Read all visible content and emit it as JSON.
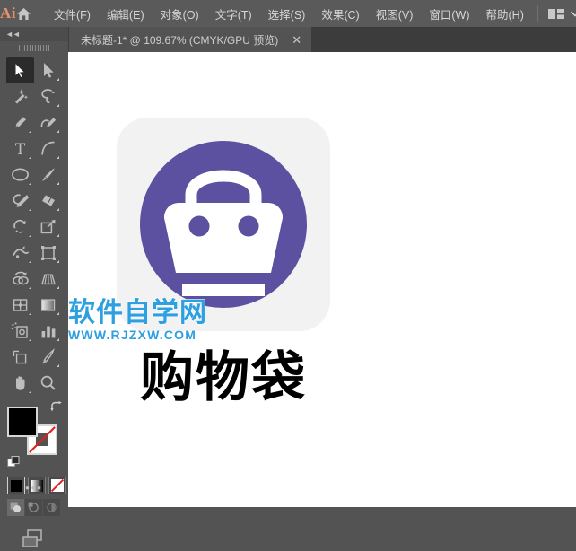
{
  "app": {
    "logo_text": "Ai",
    "accent_color": "#e8916b",
    "chrome_color": "#535353",
    "menubar_color": "#5a5a5a"
  },
  "menubar": {
    "home_icon": "home-icon",
    "items": [
      {
        "label": "文件(F)",
        "name": "menu-file"
      },
      {
        "label": "编辑(E)",
        "name": "menu-edit"
      },
      {
        "label": "对象(O)",
        "name": "menu-object"
      },
      {
        "label": "文字(T)",
        "name": "menu-type"
      },
      {
        "label": "选择(S)",
        "name": "menu-select"
      },
      {
        "label": "效果(C)",
        "name": "menu-effect"
      },
      {
        "label": "视图(V)",
        "name": "menu-view"
      },
      {
        "label": "窗口(W)",
        "name": "menu-window"
      },
      {
        "label": "帮助(H)",
        "name": "menu-help"
      }
    ],
    "workspace_icon": "workspace-switcher-icon",
    "workspace_chevron": "chevron-down-icon"
  },
  "tabbar": {
    "document_tab": "未标题-1* @ 109.67% (CMYK/GPU 预览)",
    "close_glyph": "✕"
  },
  "toolpanel": {
    "collapse_glyph": "◄◄",
    "tools": [
      {
        "name": "selection-tool",
        "title": "选择工具",
        "active": true
      },
      {
        "name": "direct-selection-tool",
        "title": "直接选择工具",
        "active": false
      },
      {
        "name": "magic-wand-tool",
        "title": "魔棒工具",
        "active": false
      },
      {
        "name": "lasso-tool",
        "title": "套索工具",
        "active": false
      },
      {
        "name": "pen-tool",
        "title": "钢笔工具",
        "active": false
      },
      {
        "name": "curvature-tool",
        "title": "曲率工具",
        "active": false
      },
      {
        "name": "type-tool",
        "title": "文字工具",
        "active": false
      },
      {
        "name": "line-segment-tool",
        "title": "直线段工具",
        "active": false
      },
      {
        "name": "ellipse-tool",
        "title": "椭圆工具",
        "active": false
      },
      {
        "name": "paintbrush-tool",
        "title": "画笔工具",
        "active": false
      },
      {
        "name": "shaper-tool",
        "title": "Shaper 工具",
        "active": false
      },
      {
        "name": "eraser-tool",
        "title": "橡皮擦工具",
        "active": false
      },
      {
        "name": "rotate-tool",
        "title": "旋转工具",
        "active": false
      },
      {
        "name": "scale-tool",
        "title": "比例缩放工具",
        "active": false
      },
      {
        "name": "width-tool",
        "title": "宽度工具",
        "active": false
      },
      {
        "name": "free-transform-tool",
        "title": "自由变换工具",
        "active": false
      },
      {
        "name": "shape-builder-tool",
        "title": "形状生成器工具",
        "active": false
      },
      {
        "name": "perspective-grid-tool",
        "title": "透视网格工具",
        "active": false
      },
      {
        "name": "mesh-tool",
        "title": "网格工具",
        "active": false
      },
      {
        "name": "gradient-tool",
        "title": "渐变工具",
        "active": false
      },
      {
        "name": "symbol-sprayer-tool",
        "title": "符号喷枪工具",
        "active": false
      },
      {
        "name": "column-graph-tool",
        "title": "柱形图工具",
        "active": false
      },
      {
        "name": "artboard-tool",
        "title": "画板工具",
        "active": false
      },
      {
        "name": "slice-tool",
        "title": "切片工具",
        "active": false
      },
      {
        "name": "hand-tool",
        "title": "抓手工具",
        "active": false
      },
      {
        "name": "zoom-tool",
        "title": "缩放工具",
        "active": false
      }
    ],
    "fill_color": "#000000",
    "stroke_color": "#ffffff",
    "swap_icon": "swap-fill-stroke-icon",
    "default_icon": "default-fill-stroke-icon",
    "color_modes": [
      {
        "name": "color-mode-solid",
        "selected": true
      },
      {
        "name": "color-mode-gradient",
        "selected": false
      },
      {
        "name": "color-mode-none",
        "selected": false
      }
    ],
    "draw_modes": [
      {
        "name": "draw-normal-mode",
        "selected": true
      },
      {
        "name": "draw-behind-mode",
        "selected": false
      },
      {
        "name": "draw-inside-mode",
        "selected": false
      }
    ],
    "screen_mode_icon": "change-screen-mode-icon",
    "more_tools_glyph": "•••"
  },
  "artwork": {
    "tile_background": "#f2f2f2",
    "badge_color": "#5b51a0",
    "bag_color": "#ffffff",
    "caption": "购物袋"
  },
  "watermark": {
    "title": "软件自学网",
    "url": "WWW.RJZXW.COM",
    "color": "#2e9fe0"
  }
}
